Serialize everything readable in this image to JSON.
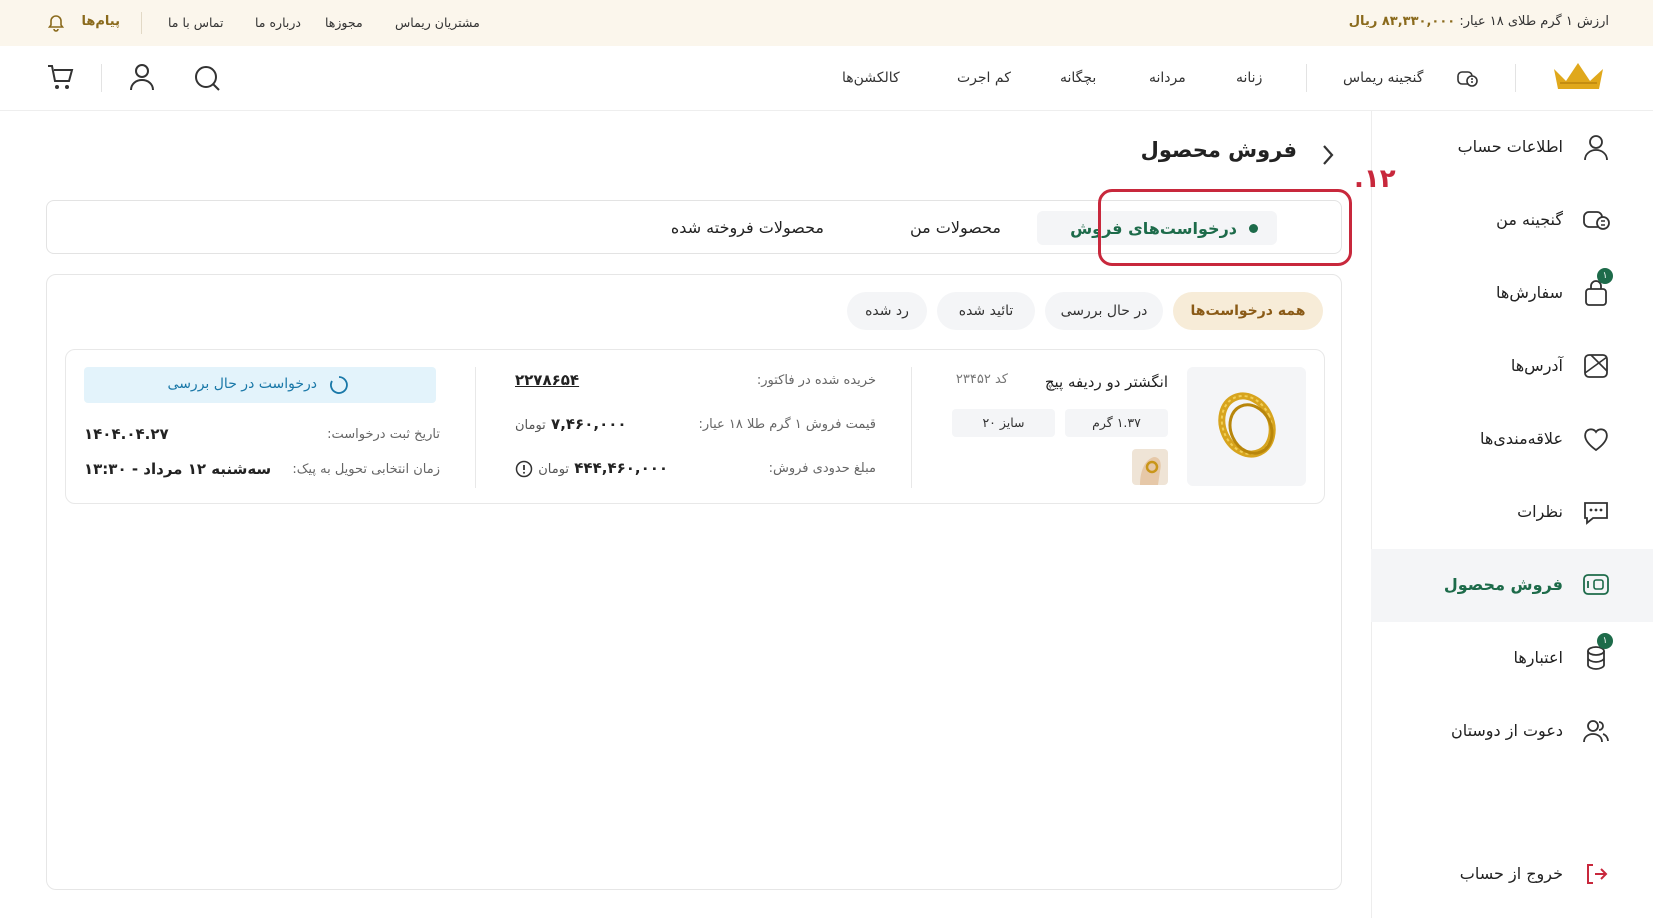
{
  "topbar": {
    "gold_label": "ارزش ۱ گرم طلای ۱۸ عیار:",
    "gold_value": "۸۳,۳۳۰,۰۰۰ ریال",
    "links": [
      "مشتریان ریماس",
      "مجوزها",
      "درباره ما",
      "تماس با ما"
    ],
    "messages_label": "پیام‌ها"
  },
  "header": {
    "treasure_label": "گنجینه ریماس",
    "nav": [
      "زنانه",
      "مردانه",
      "بچگانه",
      "کم اجرت",
      "کالکشن‌ها"
    ],
    "accent_color": "#e0a81b"
  },
  "sidebar": {
    "items": [
      {
        "label": "اطلاعات حساب",
        "icon": "user-icon"
      },
      {
        "label": "گنجینه من",
        "icon": "treasure-icon"
      },
      {
        "label": "سفارش‌ها",
        "icon": "bag-icon",
        "badge": "۱"
      },
      {
        "label": "آدرس‌ها",
        "icon": "map-icon"
      },
      {
        "label": "علاقه‌مندی‌ها",
        "icon": "heart-icon"
      },
      {
        "label": "نظرات",
        "icon": "comment-icon"
      },
      {
        "label": "فروش محصول",
        "icon": "sell-icon"
      },
      {
        "label": "اعتبارها",
        "icon": "coins-icon",
        "badge": "۱"
      },
      {
        "label": "دعوت از دوستان",
        "icon": "users-icon"
      }
    ],
    "logout_label": "خروج از حساب",
    "active_color": "#1d6b4a"
  },
  "main": {
    "title": "فروش محصول",
    "tabs": [
      "درخواست‌های فروش",
      "محصولات من",
      "محصولات فروخته شده"
    ],
    "step_number": ".۱۲",
    "filters": [
      "همه درخواست‌ها",
      "در حال بررسی",
      "تائید شده",
      "رد شده"
    ]
  },
  "request": {
    "product_name": "انگشتر دو ردیفه پیچ",
    "code": "کد ۲۳۴۵۲",
    "weight": "۱.۳۷ گرم",
    "size": "سایز ۲۰",
    "invoice_label": "خریده شده در فاکتور:",
    "invoice_value": "۲۲۷۸۶۵۴",
    "unit_price_label": "قیمت فروش ۱ گرم طلا ۱۸ عیار:",
    "unit_price_value": "۷,۴۶۰,۰۰۰",
    "estimate_label": "مبلغ حدودی فروش:",
    "estimate_value": "۴۴۴,۴۶۰,۰۰۰",
    "currency": "تومان",
    "status": "درخواست در حال بررسی",
    "date_label": "تاریخ ثبت درخواست:",
    "date_value": "۱۴۰۴.۰۴.۲۷",
    "delivery_label": "زمان انتخابی تحویل به پیک:",
    "delivery_value": "سه‌شنبه ۱۲ مرداد - ۱۳:۳۰"
  }
}
